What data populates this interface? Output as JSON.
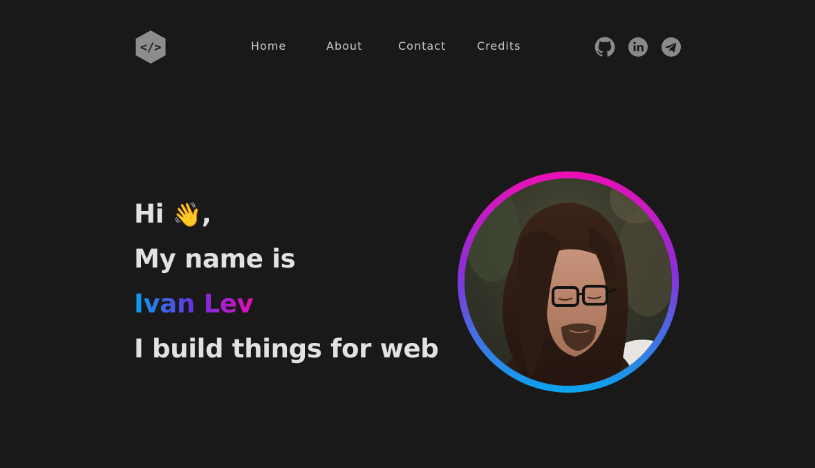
{
  "header": {
    "logo_icon": "code-brackets-hexagon-icon",
    "nav": [
      {
        "label": "Home"
      },
      {
        "label": "About"
      },
      {
        "label": "Contact"
      },
      {
        "label": "Credits"
      }
    ],
    "social": [
      {
        "icon": "github-icon"
      },
      {
        "icon": "linkedin-icon"
      },
      {
        "icon": "telegram-icon"
      }
    ]
  },
  "hero": {
    "greeting": "Hi",
    "wave_emoji": "👋",
    "greeting_suffix": ",",
    "intro": "My name is",
    "name": "Ivan Lev",
    "tagline": "I build things for web"
  },
  "avatar": {
    "icon": "profile-photo"
  },
  "colors": {
    "background": "#1a191a",
    "text": "#e2e2e2",
    "nav_text": "#c9c9c9",
    "icon_gray": "#8a8a8a",
    "gradient_blue": "#0aa0ec",
    "gradient_purple": "#6a2fe0",
    "gradient_pink": "#e010b8"
  }
}
